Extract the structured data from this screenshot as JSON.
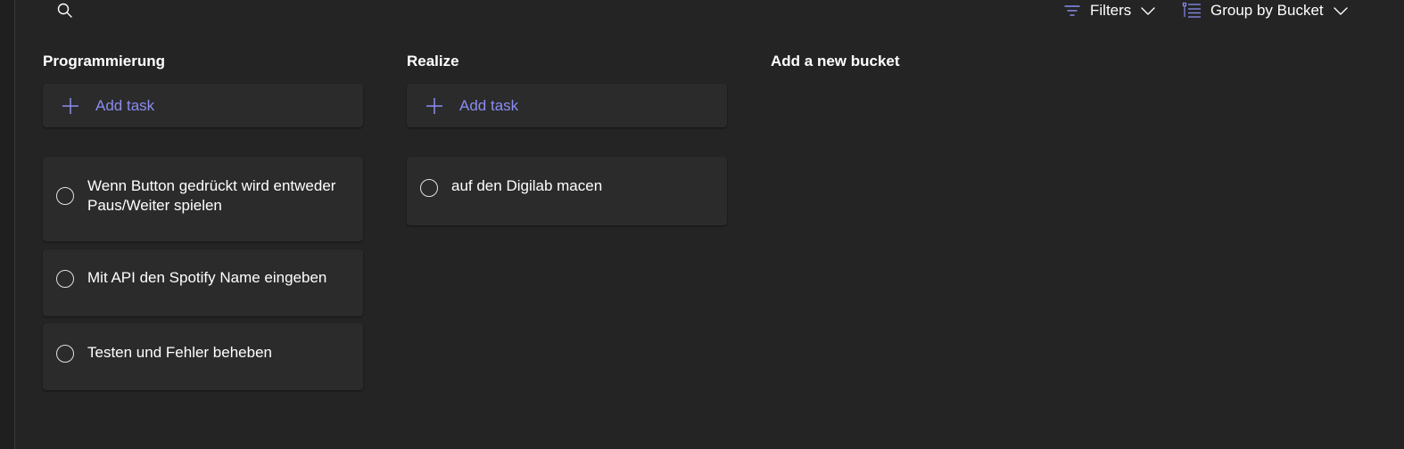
{
  "toolbar": {
    "search_icon": "search-icon",
    "filters_label": "Filters",
    "group_label": "Group by Bucket",
    "accent_color": "#8b8cf0"
  },
  "buckets": [
    {
      "title": "Programmierung",
      "add_task_label": "Add task",
      "tasks": [
        {
          "title": "Wenn Button gedrückt wird entweder Paus/Weiter spielen"
        },
        {
          "title": "Mit API den Spotify Name eingeben"
        },
        {
          "title": "Testen und Fehler beheben"
        }
      ]
    },
    {
      "title": "Realize",
      "add_task_label": "Add task",
      "tasks": [
        {
          "title": "auf den Digilab macen"
        }
      ]
    }
  ],
  "new_bucket_label": "Add a new bucket"
}
